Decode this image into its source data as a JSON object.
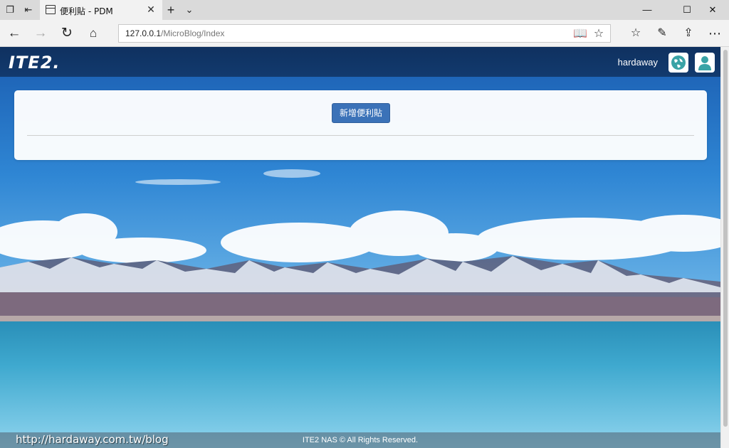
{
  "browser": {
    "tab_title": "便利貼 - PDM",
    "address_host": "127.0.0.1",
    "address_path": "/MicroBlog/Index",
    "icons": {
      "tab_manage": "tabs-icon",
      "tab_aside": "set-aside-icon",
      "new_tab": "plus-icon",
      "tab_list": "chevron-down-icon",
      "minimize": "minimize-icon",
      "maximize": "maximize-icon",
      "close": "close-icon",
      "back": "back-arrow-icon",
      "forward": "forward-arrow-icon",
      "refresh": "refresh-icon",
      "home": "home-icon",
      "reading_view": "book-icon",
      "favorite": "star-icon",
      "favorites_hub": "favorites-list-icon",
      "notes": "pen-icon",
      "share": "share-icon",
      "more": "more-icon"
    }
  },
  "app": {
    "logo_text": "ITE2.",
    "username": "hardaway",
    "add_button_label": "新增便利貼",
    "footer_text": "ITE2 NAS © All Rights Reserved.",
    "watermark": "http://hardaway.com.tw/blog",
    "colors": {
      "header": "#123a6e",
      "button": "#3b72b8",
      "icon_accent": "#3aa3a6"
    }
  }
}
